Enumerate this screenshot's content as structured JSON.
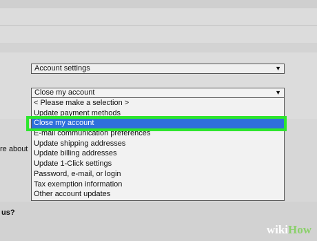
{
  "account_dropdown": {
    "value": "Account settings"
  },
  "issue_dropdown": {
    "value": "Close my account",
    "options": [
      "< Please make a selection >",
      "Update payment methods",
      "Close my account",
      "E-mail communication preferences",
      "Update shipping addresses",
      "Update billing addresses",
      "Update 1-Click settings",
      "Password, e-mail, or login",
      "Tax exemption information",
      "Other account updates"
    ],
    "selected_index": 2
  },
  "page_text": {
    "side_label": "re about",
    "question_label": "us?"
  },
  "brand": {
    "part1": "wiki",
    "part2": "How"
  },
  "colors": {
    "selection_blue": "#2f6fdc",
    "highlight_green": "#2ee62e",
    "brand_green": "#8bd06b"
  },
  "icons": {
    "dropdown_arrow": "triangle-down-icon"
  }
}
